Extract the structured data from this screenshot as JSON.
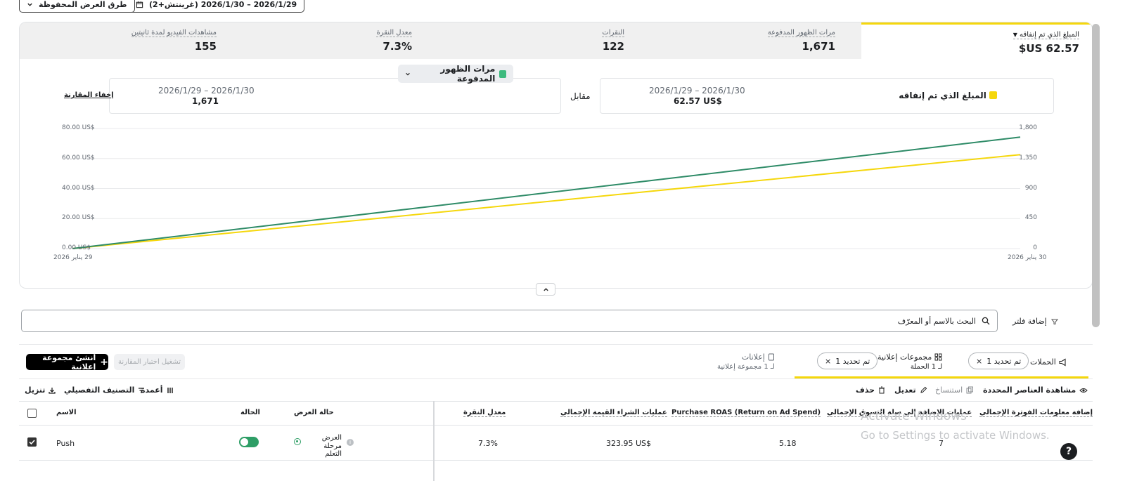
{
  "toolbar": {
    "date_range": "2026/1/29 – 2026/1/30 (غرينتش+2)",
    "saved_views": "طرق العرض المحفوظة"
  },
  "metrics": [
    {
      "label": "المبلغ الذي تم إنفاقه",
      "value": "62.57 US$",
      "active": true
    },
    {
      "label": "مرات الظهور المدفوعة",
      "value": "1,671"
    },
    {
      "label": "النقرات",
      "value": "122"
    },
    {
      "label": "معدل النقرة",
      "value": "7.3%"
    },
    {
      "label": "مشاهدات الفيديو لمدة ثانيتين",
      "value": "155"
    }
  ],
  "comparison": {
    "primary": {
      "metric": "المبلغ الذي تم إنفاقه",
      "date": "2026/1/29 – 2026/1/30",
      "value": "62.57 US$"
    },
    "versus_label": "مقابل",
    "secondary": {
      "metric": "مرات الظهور المدفوعة",
      "date": "2026/1/29 – 2026/1/30",
      "value": "1,671"
    },
    "hide_label": "إخفاء المقارنة"
  },
  "chart_data": {
    "type": "line",
    "x": [
      "29 يناير 2026",
      "30 يناير 2026"
    ],
    "series": [
      {
        "name": "المبلغ الذي تم إنفاقه",
        "axis": "left",
        "color": "#f5d70c",
        "values": [
          0,
          62.57
        ]
      },
      {
        "name": "مرات الظهور المدفوعة",
        "axis": "right",
        "color": "#2e8b67",
        "values": [
          0,
          1671
        ]
      }
    ],
    "y_left_ticks": [
      "80.00 US$",
      "60.00 US$",
      "40.00 US$",
      "20.00 US$",
      "0.00 US$"
    ],
    "y_left_range": [
      0,
      80
    ],
    "y_right_ticks": [
      "1,800",
      "1,350",
      "900",
      "450",
      "0"
    ],
    "y_right_range": [
      0,
      1800
    ],
    "x_ticks": [
      "29 يناير 2026",
      "30 يناير 2026"
    ],
    "grid": true
  },
  "filters": {
    "add_filter": "إضافة فلتر",
    "search_placeholder": "البحث بالاسم أو المعرّف"
  },
  "tabs": {
    "campaigns": {
      "label": "الحملات",
      "chip": "تم تحديد 1"
    },
    "adsets": {
      "label": "مجموعات إعلانية",
      "sub": "لـ 1 الحملة",
      "chip": "تم تحديد 1"
    },
    "ads": {
      "label": "إعلانات",
      "sub": "لـ 1 مجموعة إعلانية"
    }
  },
  "actions": {
    "create": "أنشئ مجموعة إعلانية",
    "compare": "تشغيل اختبار المقارنة",
    "view_selected": "مشاهدة العناصر المحددة",
    "duplicate": "استنساخ",
    "edit": "تعديل",
    "delete": "حذف",
    "columns": "أعمدة",
    "breakdown": "التصنيف التفصيلي",
    "export": "تنزيل"
  },
  "table": {
    "headers": {
      "name": "الاسم",
      "status": "الحالة",
      "delivery": "حالة العرض",
      "ctr": "معدل النقرة",
      "purchase_value": "عمليات الشراء القيمة الإجمالي",
      "roas": "Purchase ROAS (Return on Ad Spend)",
      "add_to_cart": "عمليات الإضافة إلى سلة التسوق الإجمالي",
      "add_payment": "إضافة معلومات الفوترة الإجمالي"
    },
    "row": {
      "name": "Push",
      "delivery_main": "العرض",
      "delivery_sub": "مرحلة التعلم",
      "ctr": "7.3%",
      "purchase_value": "323.95 US$",
      "roas": "5.18",
      "add_to_cart": "7"
    }
  },
  "overlay": {
    "activate_title": "Activate Windows",
    "activate_sub": "Go to Settings to activate Windows."
  }
}
